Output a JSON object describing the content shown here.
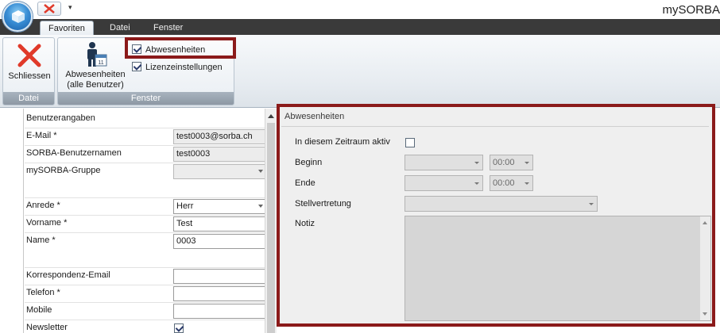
{
  "window": {
    "title": "mySORBA"
  },
  "ribbon": {
    "tabs": [
      {
        "label": "Favoriten",
        "active": true
      },
      {
        "label": "Datei",
        "active": false
      },
      {
        "label": "Fenster",
        "active": false
      }
    ],
    "groups": {
      "datei": {
        "label": "Datei",
        "close_button": "Schliessen"
      },
      "fenster": {
        "label": "Fenster",
        "absences_all_line1": "Abwesenheiten",
        "absences_all_line2": "(alle Benutzer)",
        "check_absences": {
          "label": "Abwesenheiten",
          "checked": true
        },
        "check_licenses": {
          "label": "Lizenzeinstellungen",
          "checked": true
        }
      }
    }
  },
  "user_form": {
    "section_title": "Benutzerangaben",
    "fields": [
      {
        "label": "E-Mail *",
        "value": "test0003@sorba.ch"
      },
      {
        "label": "SORBA-Benutzernamen",
        "value": "test0003"
      },
      {
        "label": "mySORBA-Gruppe",
        "value": ""
      },
      {
        "label": "Anrede *",
        "value": "Herr"
      },
      {
        "label": "Vorname *",
        "value": "Test"
      },
      {
        "label": "Name *",
        "value": "0003"
      },
      {
        "label": "Korrespondenz-Email",
        "value": ""
      },
      {
        "label": "Telefon *",
        "value": ""
      },
      {
        "label": "Mobile",
        "value": ""
      },
      {
        "label": "Newsletter",
        "checked": true
      }
    ]
  },
  "absences_panel": {
    "title": "Abwesenheiten",
    "active_label": "In diesem Zeitraum aktiv",
    "active_checked": false,
    "begin_label": "Beginn",
    "begin_time": "00:00",
    "end_label": "Ende",
    "end_time": "00:00",
    "substitute_label": "Stellvertretung",
    "note_label": "Notiz"
  },
  "colors": {
    "highlight": "#8b1a1a",
    "tabbar": "#3a3a3a",
    "close_x": "#e03a2a"
  },
  "icons": [
    "app-orb-icon",
    "close-x-icon",
    "menu-dropdown-icon",
    "absences-calendar-icon"
  ]
}
